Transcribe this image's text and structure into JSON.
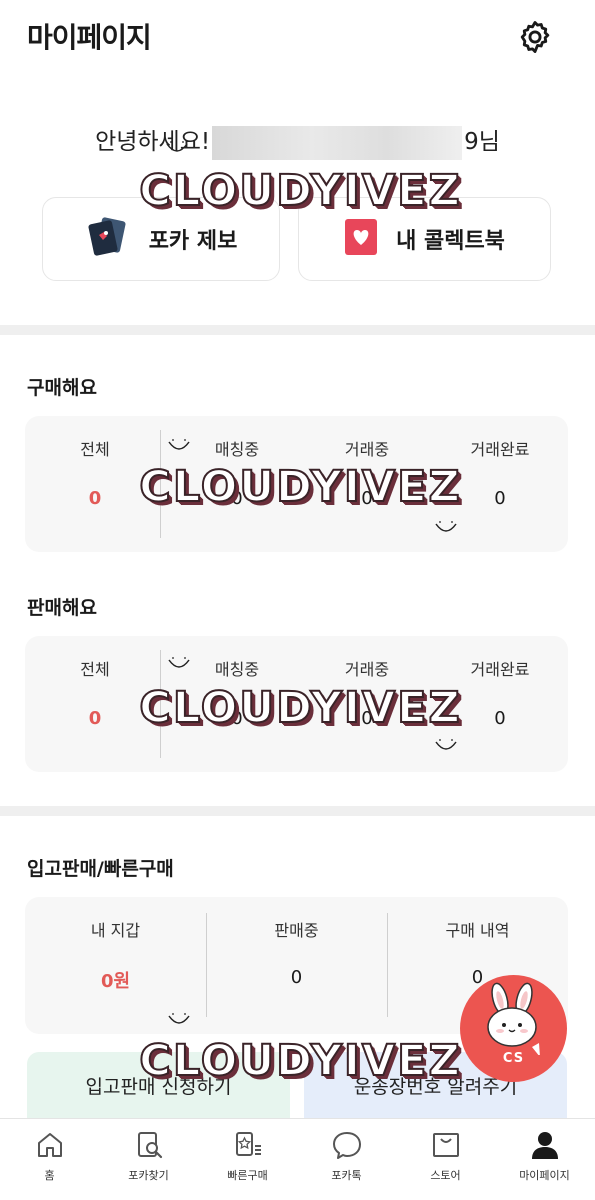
{
  "header": {
    "title": "마이페이지",
    "settings_icon": "gear-icon"
  },
  "greeting": {
    "prefix": "안녕하세요!",
    "suffix": "9님"
  },
  "quick_actions": [
    {
      "label": "포카 제보",
      "icon": "photocards-icon"
    },
    {
      "label": "내 콜렉트북",
      "icon": "heart-book-icon"
    }
  ],
  "buy": {
    "title": "구매해요",
    "columns": [
      {
        "label": "전체",
        "value": "0"
      },
      {
        "label": "매칭중",
        "value": "0"
      },
      {
        "label": "거래중",
        "value": "0"
      },
      {
        "label": "거래완료",
        "value": "0"
      }
    ]
  },
  "sell": {
    "title": "판매해요",
    "columns": [
      {
        "label": "전체",
        "value": "0"
      },
      {
        "label": "매칭중",
        "value": "0"
      },
      {
        "label": "거래중",
        "value": "0"
      },
      {
        "label": "거래완료",
        "value": "0"
      }
    ]
  },
  "quick_trade": {
    "title": "입고판매/빠른구매",
    "columns": [
      {
        "label": "내 지갑",
        "value": "0원"
      },
      {
        "label": "판매중",
        "value": "0"
      },
      {
        "label": "구매 내역",
        "value": "0"
      }
    ],
    "consign_button": "입고판매 신청하기",
    "tracking_button": "운송장번호 알려주기"
  },
  "cs_button": {
    "label": "CS"
  },
  "watermark": "CLOUDYIVEZ",
  "tabbar": [
    {
      "label": "홈",
      "icon": "home-icon"
    },
    {
      "label": "포카찾기",
      "icon": "card-search-icon"
    },
    {
      "label": "빠른구매",
      "icon": "star-card-list-icon"
    },
    {
      "label": "포카톡",
      "icon": "chat-bubble-icon"
    },
    {
      "label": "스토어",
      "icon": "shopping-bag-icon"
    },
    {
      "label": "마이페이지",
      "icon": "person-icon"
    }
  ],
  "colors": {
    "accent_red": "#e25a57",
    "cs_red": "#ec5550",
    "consign_bg": "#e7f5ee",
    "tracking_bg": "#e5edfa"
  }
}
